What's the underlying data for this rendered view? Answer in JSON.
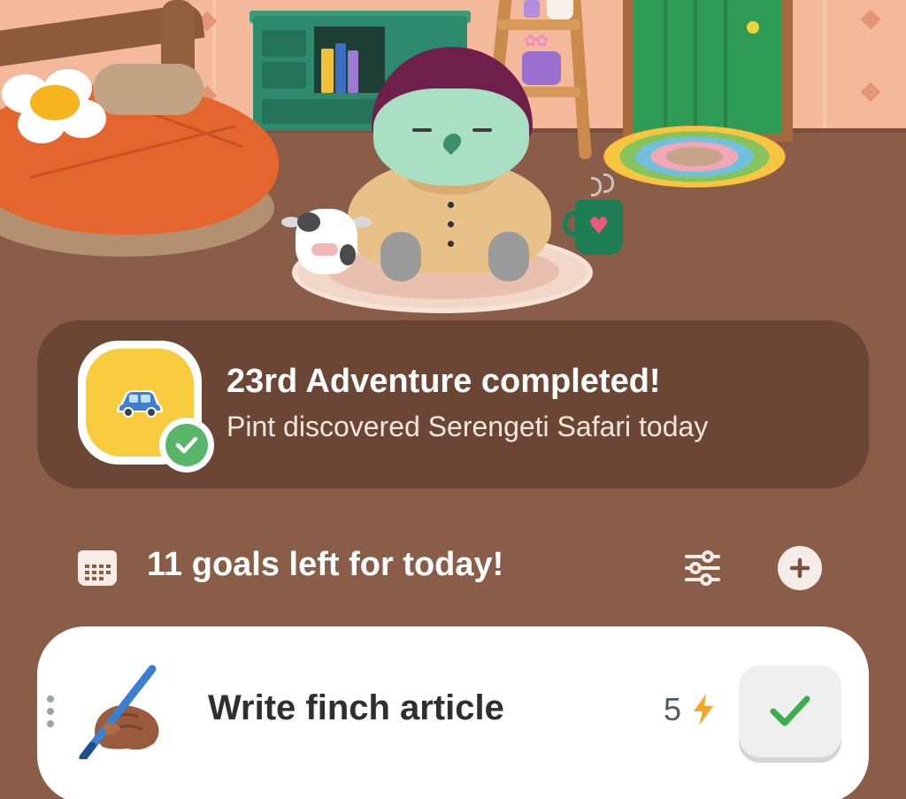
{
  "scene": {
    "characters": [
      "bird-pet",
      "cow-plush"
    ],
    "colors": {
      "wall": "#f4b99a",
      "floor": "#8a5d48",
      "bird_hat": "#6e1f4a",
      "bird_face": "#a9dfc3"
    }
  },
  "adventure": {
    "title": "23rd Adventure completed!",
    "subtitle": "Pint discovered Serengeti Safari today",
    "badge_icon": "car-icon",
    "status_icon": "check-icon",
    "colors": {
      "card": "#6b4634",
      "badge": "#f9cb3e",
      "check": "#58b56a"
    }
  },
  "goals_header": {
    "title": "11 goals left for today!",
    "icons": {
      "calendar": "calendar-icon",
      "filter": "sliders-icon",
      "add": "plus-icon"
    }
  },
  "goal": {
    "title": "Write finch article",
    "energy": "5",
    "emoji": "writing-hand-icon",
    "energy_icon": "lightning-bolt-icon",
    "complete_icon": "check-icon",
    "colors": {
      "check": "#3cae4c",
      "bolt": "#f6a623"
    }
  }
}
